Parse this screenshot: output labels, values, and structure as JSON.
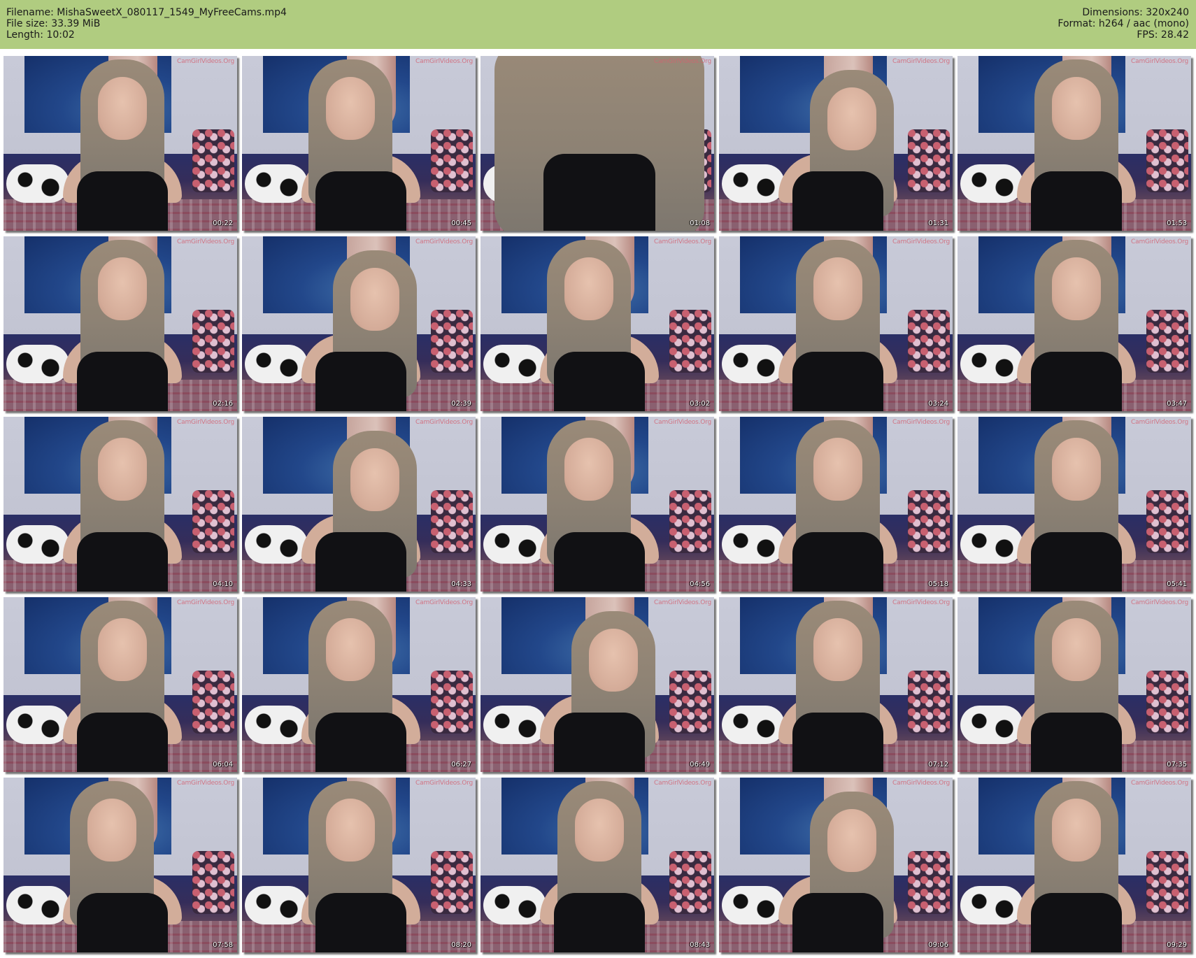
{
  "header": {
    "filename_label": "Filename: MishaSweetX_080117_1549_MyFreeCams.mp4",
    "filesize_label": "File size: 33.39 MiB",
    "length_label": "Length: 10:02",
    "dimensions_label": "Dimensions: 320x240",
    "format_label": "Format: h264 / aac (mono)",
    "fps_label": "FPS: 28.42"
  },
  "thumbnails": [
    {
      "timestamp": "00:22"
    },
    {
      "timestamp": "00:45"
    },
    {
      "timestamp": "01:08"
    },
    {
      "timestamp": "01:31"
    },
    {
      "timestamp": "01:53"
    },
    {
      "timestamp": "02:16"
    },
    {
      "timestamp": "02:39"
    },
    {
      "timestamp": "03:02"
    },
    {
      "timestamp": "03:24"
    },
    {
      "timestamp": "03:47"
    },
    {
      "timestamp": "04:10"
    },
    {
      "timestamp": "04:33"
    },
    {
      "timestamp": "04:56"
    },
    {
      "timestamp": "05:18"
    },
    {
      "timestamp": "05:41"
    },
    {
      "timestamp": "06:04"
    },
    {
      "timestamp": "06:27"
    },
    {
      "timestamp": "06:49"
    },
    {
      "timestamp": "07:12"
    },
    {
      "timestamp": "07:35"
    },
    {
      "timestamp": "07:58"
    },
    {
      "timestamp": "08:20"
    },
    {
      "timestamp": "08:43"
    },
    {
      "timestamp": "09:06"
    },
    {
      "timestamp": "09:29"
    }
  ],
  "watermark_text": "CamGirlVideos.Org",
  "colors": {
    "header_bg": "#b0cc80",
    "page_bg": "#ffffff"
  }
}
